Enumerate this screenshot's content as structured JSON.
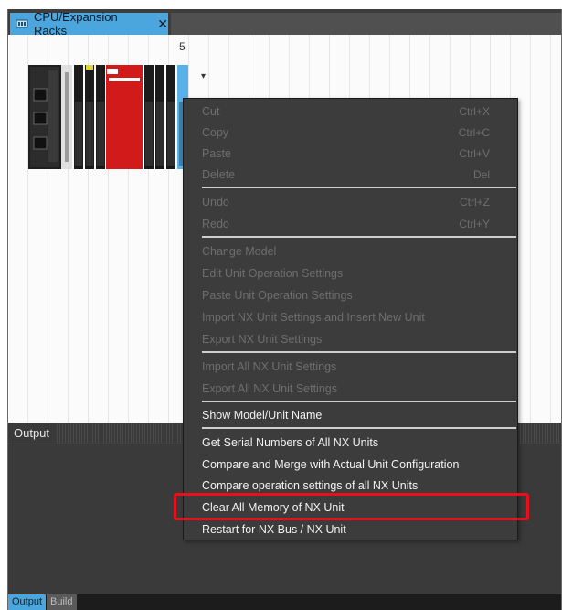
{
  "tab": {
    "title": "CPU/Expansion Racks",
    "close_glyph": "✕"
  },
  "canvas": {
    "slot_number": "5",
    "dropdown_glyph": "▾"
  },
  "output": {
    "title": "Output",
    "tabs": [
      {
        "label": "Output"
      },
      {
        "label": "Build"
      }
    ]
  },
  "menu": {
    "items": [
      {
        "label": "Cut",
        "shortcut": "Ctrl+X"
      },
      {
        "label": "Copy",
        "shortcut": "Ctrl+C"
      },
      {
        "label": "Paste",
        "shortcut": "Ctrl+V"
      },
      {
        "label": "Delete",
        "shortcut": "Del"
      },
      {
        "label": "Undo",
        "shortcut": "Ctrl+Z"
      },
      {
        "label": "Redo",
        "shortcut": "Ctrl+Y"
      },
      {
        "label": "Change Model"
      },
      {
        "label": "Edit Unit Operation Settings"
      },
      {
        "label": "Paste Unit Operation Settings"
      },
      {
        "label": "Import NX Unit Settings and Insert New Unit"
      },
      {
        "label": "Export NX Unit Settings"
      },
      {
        "label": "Import All NX Unit Settings"
      },
      {
        "label": "Export All NX Unit Settings"
      },
      {
        "label": "Show Model/Unit Name"
      },
      {
        "label": "Get Serial Numbers of All NX Units"
      },
      {
        "label": "Compare and Merge with Actual Unit Configuration"
      },
      {
        "label": "Compare operation settings of all NX Units"
      },
      {
        "label": "Clear All Memory of NX Unit"
      },
      {
        "label": "Restart for NX Bus / NX Unit"
      }
    ]
  },
  "colors": {
    "accent_tab": "#4aa6dc",
    "highlight": "#e8101c",
    "menu_bg": "#3c3c3c",
    "menu_disabled_text": "#6e6e6e",
    "menu_enabled_text": "#f2f2f2",
    "rack_red": "#d21a1a"
  }
}
